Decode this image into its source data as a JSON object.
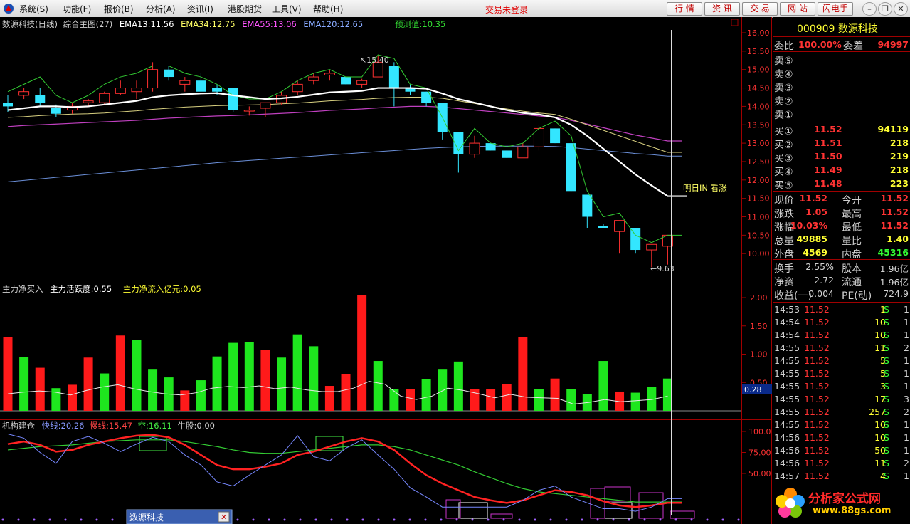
{
  "menubar": {
    "items": [
      "系统(S)",
      "功能(F)",
      "报价(B)",
      "分析(A)",
      "资讯(I)",
      "港股期货",
      "工具(V)",
      "帮助(H)"
    ],
    "login_status": "交易未登录",
    "buttons": [
      "行 情",
      "资 讯",
      "交 易",
      "网 站",
      "闪电手"
    ]
  },
  "chart_header": {
    "name": "数源科技(日线)",
    "main": "综合主图(27)",
    "ema13": "EMA13:11.56",
    "ema34": "EMA34:12.75",
    "ema55": "EMA55:13.06",
    "ema120": "EMA120:12.65",
    "forecast": "预测值:10.35",
    "high_label": "15.40",
    "low_label": "9.63",
    "signal": "明日IN 看涨"
  },
  "indicator1_header": {
    "name": "主力净买入",
    "activity": "主力活跃度:0.55",
    "inflow": "主力净流入亿元:0.05",
    "cursor_value": "0.28"
  },
  "indicator2_header": {
    "name": "机构建仓",
    "fast": "快线:20.26",
    "slow": "慢线:15.47",
    "empty": "空:16.11",
    "bull": "牛股:0.00"
  },
  "price_axis": [
    "16.00",
    "15.50",
    "15.00",
    "14.50",
    "14.00",
    "13.50",
    "13.00",
    "12.50",
    "12.00",
    "11.50",
    "11.00",
    "10.50",
    "10.00"
  ],
  "ind1_axis": [
    "2.00",
    "1.50",
    "1.00",
    "0.50"
  ],
  "ind2_axis": [
    "100.0",
    "75.00",
    "50.00"
  ],
  "chart_data": {
    "type": "candlestick",
    "candles": [
      [
        14.1,
        14.3,
        13.85,
        14.0
      ],
      [
        14.3,
        14.5,
        14.2,
        14.4
      ],
      [
        14.3,
        14.5,
        14.0,
        14.1
      ],
      [
        13.95,
        14.05,
        13.7,
        13.8
      ],
      [
        13.9,
        14.1,
        13.8,
        14.0
      ],
      [
        14.1,
        14.2,
        14.0,
        14.15
      ],
      [
        14.1,
        14.4,
        14.05,
        14.35
      ],
      [
        14.35,
        14.7,
        14.3,
        14.5
      ],
      [
        14.4,
        14.7,
        14.2,
        14.5
      ],
      [
        14.5,
        15.2,
        14.4,
        15.0
      ],
      [
        15.0,
        15.1,
        14.7,
        14.8
      ],
      [
        14.6,
        14.8,
        14.4,
        14.7
      ],
      [
        14.7,
        14.9,
        14.4,
        14.4
      ],
      [
        14.5,
        14.6,
        14.3,
        14.4
      ],
      [
        14.5,
        14.5,
        13.85,
        13.9
      ],
      [
        13.9,
        14.0,
        13.75,
        13.9
      ],
      [
        13.95,
        14.1,
        13.7,
        14.1
      ],
      [
        14.1,
        14.4,
        14.05,
        14.3
      ],
      [
        14.4,
        14.7,
        14.3,
        14.6
      ],
      [
        14.7,
        14.9,
        14.6,
        14.8
      ],
      [
        14.85,
        15.0,
        14.7,
        14.9
      ],
      [
        14.8,
        14.8,
        14.6,
        14.6
      ],
      [
        14.6,
        14.75,
        14.5,
        14.7
      ],
      [
        14.8,
        15.4,
        14.8,
        15.2
      ],
      [
        15.1,
        15.2,
        14.0,
        14.5
      ],
      [
        14.5,
        14.6,
        14.3,
        14.4
      ],
      [
        14.4,
        14.4,
        14.0,
        14.1
      ],
      [
        14.1,
        14.1,
        13.1,
        13.3
      ],
      [
        13.3,
        13.3,
        12.2,
        12.7
      ],
      [
        12.7,
        13.2,
        12.6,
        13.0
      ],
      [
        13.0,
        13.0,
        12.8,
        12.8
      ],
      [
        12.8,
        12.8,
        12.6,
        12.6
      ],
      [
        12.6,
        13.0,
        12.6,
        12.9
      ],
      [
        12.9,
        13.5,
        12.8,
        13.4
      ],
      [
        13.4,
        13.4,
        13.0,
        13.0
      ],
      [
        13.0,
        13.0,
        11.7,
        11.7
      ],
      [
        11.6,
        11.6,
        10.7,
        11.0
      ],
      [
        10.75,
        10.8,
        10.7,
        10.7
      ],
      [
        10.6,
        10.9,
        10.0,
        10.9
      ],
      [
        10.7,
        10.7,
        10.0,
        10.1
      ],
      [
        10.1,
        10.2,
        9.63,
        10.25
      ],
      [
        10.2,
        10.5,
        9.7,
        10.5
      ]
    ],
    "ema13": [
      13.9,
      13.95,
      14.0,
      14.0,
      13.98,
      14.0,
      14.05,
      14.1,
      14.15,
      14.25,
      14.3,
      14.33,
      14.35,
      14.36,
      14.3,
      14.25,
      14.2,
      14.22,
      14.26,
      14.32,
      14.38,
      14.4,
      14.42,
      14.5,
      14.5,
      14.5,
      14.48,
      14.35,
      14.2,
      14.1,
      14.0,
      13.9,
      13.82,
      13.78,
      13.7,
      13.5,
      13.2,
      12.85,
      12.5,
      12.15,
      11.85,
      11.56
    ],
    "ema34": [
      13.7,
      13.72,
      13.75,
      13.77,
      13.79,
      13.8,
      13.82,
      13.85,
      13.88,
      13.92,
      13.95,
      13.98,
      14.0,
      14.02,
      14.03,
      14.04,
      14.05,
      14.07,
      14.09,
      14.12,
      14.15,
      14.17,
      14.19,
      14.22,
      14.24,
      14.25,
      14.25,
      14.22,
      14.15,
      14.08,
      14.0,
      13.93,
      13.87,
      13.82,
      13.78,
      13.65,
      13.5,
      13.35,
      13.2,
      13.05,
      12.9,
      12.75
    ],
    "ema55": [
      13.45,
      13.48,
      13.5,
      13.52,
      13.54,
      13.56,
      13.58,
      13.6,
      13.62,
      13.65,
      13.68,
      13.7,
      13.72,
      13.74,
      13.75,
      13.77,
      13.79,
      13.81,
      13.83,
      13.86,
      13.89,
      13.91,
      13.93,
      13.96,
      13.98,
      14.0,
      14.0,
      13.98,
      13.94,
      13.9,
      13.86,
      13.82,
      13.78,
      13.74,
      13.7,
      13.62,
      13.52,
      13.42,
      13.32,
      13.22,
      13.14,
      13.06
    ],
    "ema120": [
      11.95,
      11.99,
      12.03,
      12.07,
      12.11,
      12.15,
      12.19,
      12.23,
      12.27,
      12.31,
      12.35,
      12.39,
      12.43,
      12.47,
      12.5,
      12.53,
      12.56,
      12.59,
      12.62,
      12.65,
      12.68,
      12.71,
      12.74,
      12.77,
      12.8,
      12.83,
      12.86,
      12.88,
      12.9,
      12.91,
      12.92,
      12.92,
      12.92,
      12.92,
      12.91,
      12.88,
      12.84,
      12.8,
      12.76,
      12.72,
      12.69,
      12.65
    ],
    "forecast_line": [
      14.4,
      14.6,
      14.8,
      14.3,
      14.1,
      14.3,
      14.6,
      14.8,
      14.9,
      15.1,
      15.1,
      14.9,
      14.8,
      14.6,
      14.3,
      14.2,
      14.2,
      14.4,
      14.7,
      14.9,
      15.0,
      14.8,
      14.8,
      15.4,
      15.3,
      14.6,
      14.5,
      13.7,
      12.8,
      13.4,
      13.0,
      12.9,
      13.0,
      13.4,
      13.6,
      13.2,
      11.7,
      11.0,
      11.1,
      10.5,
      10.3,
      10.5
    ],
    "net_buy": [
      1.3,
      0.95,
      0.76,
      0.4,
      0.46,
      0.94,
      0.66,
      1.33,
      1.25,
      0.74,
      0.59,
      0.36,
      0.54,
      0.96,
      1.2,
      1.22,
      1.07,
      0.94,
      1.35,
      1.14,
      0.44,
      0.65,
      2.05,
      0.88,
      0.38,
      0.38,
      0.56,
      0.74,
      0.87,
      0.38,
      0.38,
      0.47,
      1.3,
      0.38,
      0.57,
      0.38,
      0.29,
      0.88,
      0.34,
      0.32,
      0.42,
      0.57
    ],
    "net_buy_up": [
      true,
      false,
      true,
      false,
      true,
      true,
      false,
      true,
      false,
      false,
      false,
      true,
      false,
      false,
      false,
      false,
      true,
      false,
      false,
      false,
      true,
      true,
      true,
      false,
      false,
      true,
      false,
      false,
      false,
      true,
      true,
      true,
      true,
      false,
      true,
      false,
      false,
      false,
      true,
      false,
      false,
      false
    ],
    "activity_line": [
      0.3,
      0.33,
      0.35,
      0.33,
      0.28,
      0.36,
      0.42,
      0.46,
      0.39,
      0.34,
      0.3,
      0.28,
      0.32,
      0.4,
      0.43,
      0.41,
      0.44,
      0.39,
      0.42,
      0.37,
      0.34,
      0.34,
      0.4,
      0.52,
      0.47,
      0.26,
      0.2,
      0.26,
      0.4,
      0.36,
      0.3,
      0.23,
      0.29,
      0.24,
      0.23,
      0.22,
      0.12,
      0.15,
      0.2,
      0.16,
      0.18,
      0.2,
      0.26
    ],
    "fast_line": [
      97,
      92,
      75,
      62,
      88,
      94,
      86,
      76,
      85,
      93,
      88,
      72,
      60,
      40,
      35,
      48,
      60,
      72,
      95,
      70,
      65,
      80,
      90,
      72,
      55,
      33,
      22,
      10,
      10,
      10,
      10,
      10,
      18,
      30,
      35,
      22,
      15,
      8,
      8,
      5,
      10,
      20
    ],
    "slow_line": [
      85,
      88,
      84,
      76,
      78,
      84,
      88,
      92,
      95,
      96,
      93,
      84,
      72,
      60,
      55,
      55,
      58,
      62,
      72,
      76,
      82,
      88,
      92,
      88,
      78,
      62,
      48,
      38,
      30,
      22,
      18,
      15,
      18,
      24,
      30,
      28,
      24,
      17,
      12,
      10,
      12,
      15
    ],
    "empty_line": [
      78,
      80,
      82,
      83,
      84,
      86,
      88,
      89,
      90,
      90,
      90,
      88,
      85,
      82,
      78,
      75,
      74,
      74,
      76,
      78,
      80,
      82,
      84,
      84,
      82,
      78,
      72,
      66,
      60,
      52,
      45,
      38,
      32,
      28,
      26,
      24,
      22,
      20,
      18,
      16,
      16,
      16
    ]
  },
  "quote": {
    "code": "000909",
    "name": "数源科技",
    "weibi_label": "委比",
    "weibi": "100.00%",
    "weicha_label": "委差",
    "weicha": "94997",
    "sells": [
      "卖⑤",
      "卖④",
      "卖③",
      "卖②",
      "卖①"
    ],
    "buys": [
      {
        "label": "买①",
        "price": "11.52",
        "vol": "94119"
      },
      {
        "label": "买②",
        "price": "11.51",
        "vol": "218"
      },
      {
        "label": "买③",
        "price": "11.50",
        "vol": "219"
      },
      {
        "label": "买④",
        "price": "11.49",
        "vol": "218"
      },
      {
        "label": "买⑤",
        "price": "11.48",
        "vol": "223"
      }
    ],
    "stats": [
      [
        "现价",
        "11.52",
        "今开",
        "11.52"
      ],
      [
        "涨跌",
        "1.05",
        "最高",
        "11.52"
      ],
      [
        "涨幅",
        "10.03%",
        "最低",
        "11.52"
      ],
      [
        "总量",
        "49885",
        "量比",
        "1.40"
      ],
      [
        "外盘",
        "4569",
        "内盘",
        "45316"
      ]
    ],
    "stats2": [
      [
        "换手",
        "2.55%",
        "股本",
        "1.96亿"
      ],
      [
        "净资",
        "2.72",
        "流通",
        "1.96亿"
      ],
      [
        "收益(一)",
        "0.004",
        "PE(动)",
        "724.9"
      ]
    ]
  },
  "ticks": [
    [
      "14:53",
      "11.52",
      "1",
      "S",
      "1"
    ],
    [
      "14:54",
      "11.52",
      "10",
      "S",
      "1"
    ],
    [
      "14:54",
      "11.52",
      "10",
      "S",
      "1"
    ],
    [
      "14:55",
      "11.52",
      "11",
      "S",
      "2"
    ],
    [
      "14:55",
      "11.52",
      "5",
      "S",
      "1"
    ],
    [
      "14:55",
      "11.52",
      "5",
      "S",
      "1"
    ],
    [
      "14:55",
      "11.52",
      "3",
      "S",
      "1"
    ],
    [
      "14:55",
      "11.52",
      "17",
      "S",
      "3"
    ],
    [
      "14:55",
      "11.52",
      "257",
      "S",
      "2"
    ],
    [
      "14:55",
      "11.52",
      "10",
      "S",
      "1"
    ],
    [
      "14:56",
      "11.52",
      "10",
      "S",
      "1"
    ],
    [
      "14:56",
      "11.52",
      "50",
      "S",
      "1"
    ],
    [
      "14:56",
      "11.52",
      "11",
      "S",
      "2"
    ],
    [
      "14:57",
      "11.52",
      "4",
      "S",
      "1"
    ]
  ],
  "watermark": {
    "title": "分析家公式网",
    "url": "www.88gs.com"
  },
  "bottom_tab": "数源科技"
}
